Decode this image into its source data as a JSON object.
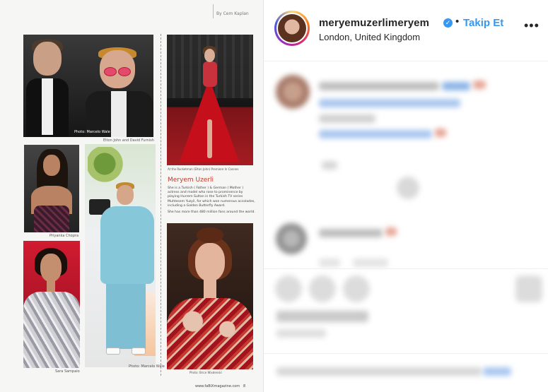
{
  "magazine": {
    "byline": "By Cem Kaplan",
    "captions": {
      "elton_david": "Elton John and David Furnish",
      "photo_credit_1": "Photo: Marcelo Wale",
      "red_carpet": "At the Rocketman (Elton John) Premiere In Cannes",
      "priyanka": "Priyanka Chopra",
      "sara": "Sara Sampaio",
      "elton_blue": "Photo: Marcelo Wale",
      "meryem_credit": "Photo: Brice Wixdenski"
    },
    "article": {
      "title": "Meryem Uzerli",
      "paragraphs": [
        "She is a Turkish ( Father ) & German ( Mother ) actress and model who rose to prominence by playing Hurrem Sultan in the Turkish TV series Muhtesem Yuzyil, for which won numerous accolades, including a Golden Butterfly Award.",
        "She has more than 480 million fans around the world."
      ]
    },
    "website": "www.faBiXmagazine.com",
    "page": "8"
  },
  "post_header": {
    "username": "meryemuzerlimeryem",
    "verified_icon": "verified-badge-icon",
    "separator": "•",
    "follow_label": "Takip Et",
    "location": "London, United Kingdom",
    "more_label": "•••"
  },
  "colors": {
    "follow_blue": "#3897f0",
    "text_dark": "#262626",
    "border": "#efefef"
  }
}
